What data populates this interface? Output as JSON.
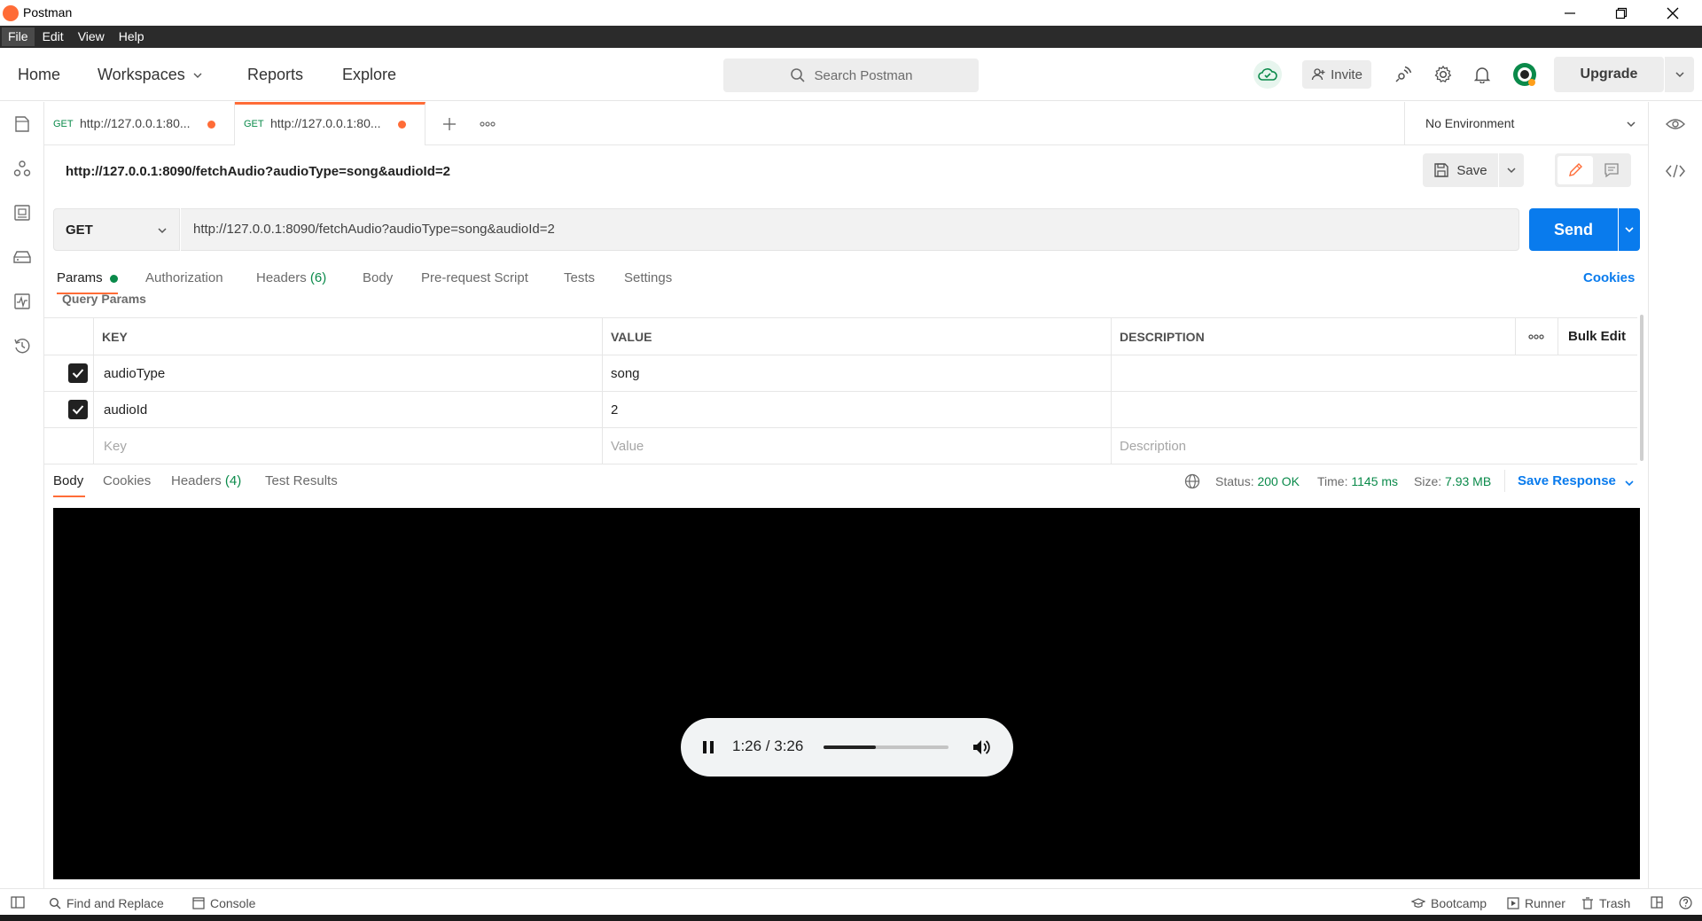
{
  "window": {
    "title": "Postman",
    "controls": [
      "minimize",
      "restore",
      "close"
    ]
  },
  "menu": [
    "File",
    "Edit",
    "View",
    "Help"
  ],
  "header": {
    "nav": {
      "home": "Home",
      "workspaces": "Workspaces",
      "reports": "Reports",
      "explore": "Explore"
    },
    "search_placeholder": "Search Postman",
    "invite": "Invite",
    "upgrade": "Upgrade"
  },
  "tabs": [
    {
      "method": "GET",
      "url": "http://127.0.0.1:80...",
      "unsaved": true,
      "active": false
    },
    {
      "method": "GET",
      "url": "http://127.0.0.1:80...",
      "unsaved": true,
      "active": true
    }
  ],
  "environment": {
    "selected": "No Environment"
  },
  "request": {
    "name": "http://127.0.0.1:8090/fetchAudio?audioType=song&audioId=2",
    "method": "GET",
    "url": "http://127.0.0.1:8090/fetchAudio?audioType=song&audioId=2",
    "save_label": "Save",
    "send_label": "Send"
  },
  "request_tabs": {
    "params": "Params",
    "authorization": "Authorization",
    "headers": "Headers",
    "headers_count": "(6)",
    "body": "Body",
    "prerequest": "Pre-request Script",
    "tests": "Tests",
    "settings": "Settings",
    "cookies": "Cookies"
  },
  "query_params": {
    "title": "Query Params",
    "columns": {
      "key": "KEY",
      "value": "VALUE",
      "description": "DESCRIPTION"
    },
    "bulk_edit": "Bulk Edit",
    "rows": [
      {
        "checked": true,
        "key": "audioType",
        "value": "song",
        "description": ""
      },
      {
        "checked": true,
        "key": "audioId",
        "value": "2",
        "description": ""
      }
    ],
    "placeholders": {
      "key": "Key",
      "value": "Value",
      "description": "Description"
    }
  },
  "response": {
    "tabs": {
      "body": "Body",
      "cookies": "Cookies",
      "headers": "Headers",
      "headers_count": "(4)",
      "test_results": "Test Results"
    },
    "status_label": "Status:",
    "status": "200 OK",
    "time_label": "Time:",
    "time": "1145 ms",
    "size_label": "Size:",
    "size": "7.93 MB",
    "save_response": "Save Response"
  },
  "audio_player": {
    "state": "playing",
    "time": "1:26 / 3:26",
    "progress_fraction": 0.42
  },
  "statusbar": {
    "find_replace": "Find and Replace",
    "console": "Console",
    "bootcamp": "Bootcamp",
    "runner": "Runner",
    "trash": "Trash"
  },
  "colors": {
    "accent_orange": "#ff6c37",
    "primary_blue": "#097bed",
    "success_green": "#0a8a4a"
  }
}
